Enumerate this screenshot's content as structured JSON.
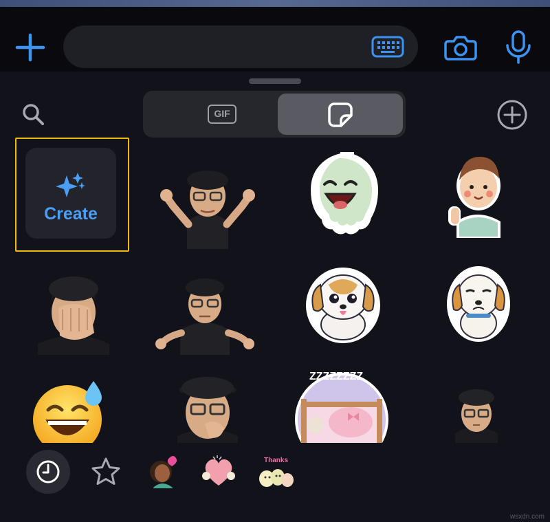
{
  "input_bar": {
    "plus_icon": "plus-icon",
    "keyboard_icon": "keyboard-icon",
    "camera_icon": "camera-icon",
    "mic_icon": "microphone-icon",
    "text_value": ""
  },
  "picker": {
    "search_icon": "search-icon",
    "tabs": [
      {
        "label": "GIF",
        "icon": "gif-badge",
        "selected": false
      },
      {
        "label": "",
        "icon": "sticker-icon",
        "selected": true
      }
    ],
    "add_icon": "plus-circle-icon"
  },
  "create_tile": {
    "label": "Create",
    "icon": "sparkles-icon",
    "accent": "#4a9ef5",
    "highlight": "#f0b90e"
  },
  "stickers": [
    {
      "name": "memoji-shrug"
    },
    {
      "name": "laughing-ghost"
    },
    {
      "name": "waving-boy"
    },
    {
      "name": "memoji-facepalm"
    },
    {
      "name": "memoji-meditate"
    },
    {
      "name": "happy-puppy"
    },
    {
      "name": "sad-puppy"
    },
    {
      "name": "sweat-smile-emoji"
    },
    {
      "name": "memoji-thinking"
    },
    {
      "name": "sleeping-zzz"
    },
    {
      "name": "memoji-small"
    }
  ],
  "bottom_tabs": [
    {
      "icon": "clock-icon",
      "selected": true
    },
    {
      "icon": "star-icon",
      "selected": false
    },
    {
      "icon": "sticker-pack-girl",
      "selected": false
    },
    {
      "icon": "sticker-pack-heart",
      "selected": false
    },
    {
      "icon": "sticker-pack-thanks",
      "selected": false
    }
  ],
  "pack_thanks_text": "Thanks",
  "sleep_text": "ZZZZZZZZ",
  "watermark": "wsxdn.com"
}
